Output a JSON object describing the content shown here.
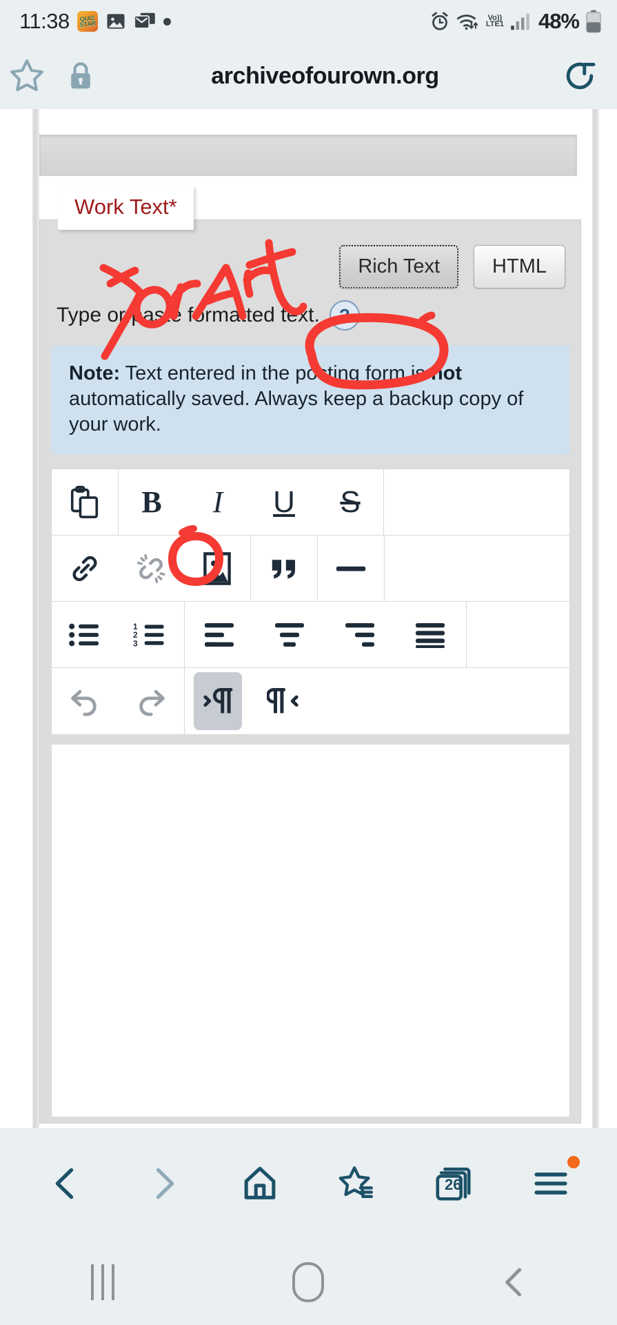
{
  "status_bar": {
    "time": "11:38",
    "icons": [
      "quiz-app-icon",
      "gallery-icon",
      "mail-icon",
      "dot-indicator"
    ],
    "quiz_label": "QUIZ STAR",
    "alarm": "alarm-icon",
    "wifi": "wifi-transfer-icon",
    "network_label_top": "Vo))",
    "network_label_bottom": "LTE1",
    "signal": "signal-bars-icon",
    "battery_percent": "48%",
    "battery": "battery-icon"
  },
  "browser": {
    "bookmark_icon": "star-icon",
    "security_icon": "lock-icon",
    "url": "archiveofourown.org",
    "reload_icon": "reload-icon",
    "bottom_nav": {
      "back": "chevron-left-icon",
      "forward": "chevron-right-icon",
      "home": "home-icon",
      "bookmarks": "star-list-icon",
      "tabs_count": "26",
      "tabs": "tabs-icon",
      "menu": "hamburger-menu-icon"
    }
  },
  "android_nav": {
    "recents": "recents-icon",
    "home": "home-pill-icon",
    "back": "back-chevron-icon"
  },
  "form": {
    "legend": "Work Text*",
    "modes": [
      {
        "label": "Rich Text",
        "active": true
      },
      {
        "label": "HTML",
        "active": false
      }
    ],
    "hint": "Type or paste formatted text.",
    "help_icon": "question-mark-icon",
    "note_prefix": "Note:",
    "note_body": " Text entered in the posting form is ",
    "note_bold": "not",
    "note_tail": " automatically saved. Always keep a backup copy of your work."
  },
  "editor_toolbar": {
    "rows": [
      {
        "groups": [
          {
            "buttons": [
              {
                "name": "paste-icon",
                "title": "Paste",
                "state": "normal"
              }
            ]
          },
          {
            "buttons": [
              {
                "name": "bold-icon",
                "title": "B",
                "state": "normal"
              },
              {
                "name": "italic-icon",
                "title": "I",
                "state": "normal"
              },
              {
                "name": "underline-icon",
                "title": "U",
                "state": "normal"
              },
              {
                "name": "strikethrough-icon",
                "title": "S",
                "state": "normal"
              }
            ]
          },
          {
            "buttons": []
          }
        ]
      },
      {
        "groups": [
          {
            "buttons": [
              {
                "name": "link-icon",
                "title": "Link",
                "state": "normal"
              },
              {
                "name": "unlink-icon",
                "title": "Unlink",
                "state": "disabled"
              },
              {
                "name": "image-icon",
                "title": "Image",
                "state": "highlighted-by-annotation"
              }
            ]
          },
          {
            "buttons": [
              {
                "name": "blockquote-icon",
                "title": "Blockquote",
                "state": "normal"
              }
            ]
          },
          {
            "buttons": [
              {
                "name": "horizontal-rule-icon",
                "title": "Horizontal rule",
                "state": "normal"
              }
            ]
          },
          {
            "buttons": []
          }
        ]
      },
      {
        "groups": [
          {
            "buttons": [
              {
                "name": "bullet-list-icon",
                "title": "Bulleted list",
                "state": "normal"
              },
              {
                "name": "numbered-list-icon",
                "title": "Numbered list",
                "state": "normal"
              }
            ]
          },
          {
            "buttons": [
              {
                "name": "align-left-icon",
                "title": "Align left",
                "state": "normal"
              },
              {
                "name": "align-center-icon",
                "title": "Align center",
                "state": "normal"
              },
              {
                "name": "align-right-icon",
                "title": "Align right",
                "state": "normal"
              },
              {
                "name": "align-justify-icon",
                "title": "Justify",
                "state": "normal"
              }
            ]
          },
          {
            "buttons": []
          }
        ]
      },
      {
        "groups": [
          {
            "buttons": [
              {
                "name": "undo-icon",
                "title": "Undo",
                "state": "disabled"
              },
              {
                "name": "redo-icon",
                "title": "Redo",
                "state": "disabled"
              }
            ]
          },
          {
            "buttons": [
              {
                "name": "text-direction-ltr-icon",
                "title": "Left to right",
                "state": "active"
              },
              {
                "name": "text-direction-rtl-icon",
                "title": "Right to left",
                "state": "normal"
              }
            ]
          }
        ]
      }
    ]
  },
  "annotations": {
    "handwritten_text": "For Art",
    "color": "#f03030",
    "circled_targets": [
      "Rich Text",
      "image-icon"
    ]
  }
}
